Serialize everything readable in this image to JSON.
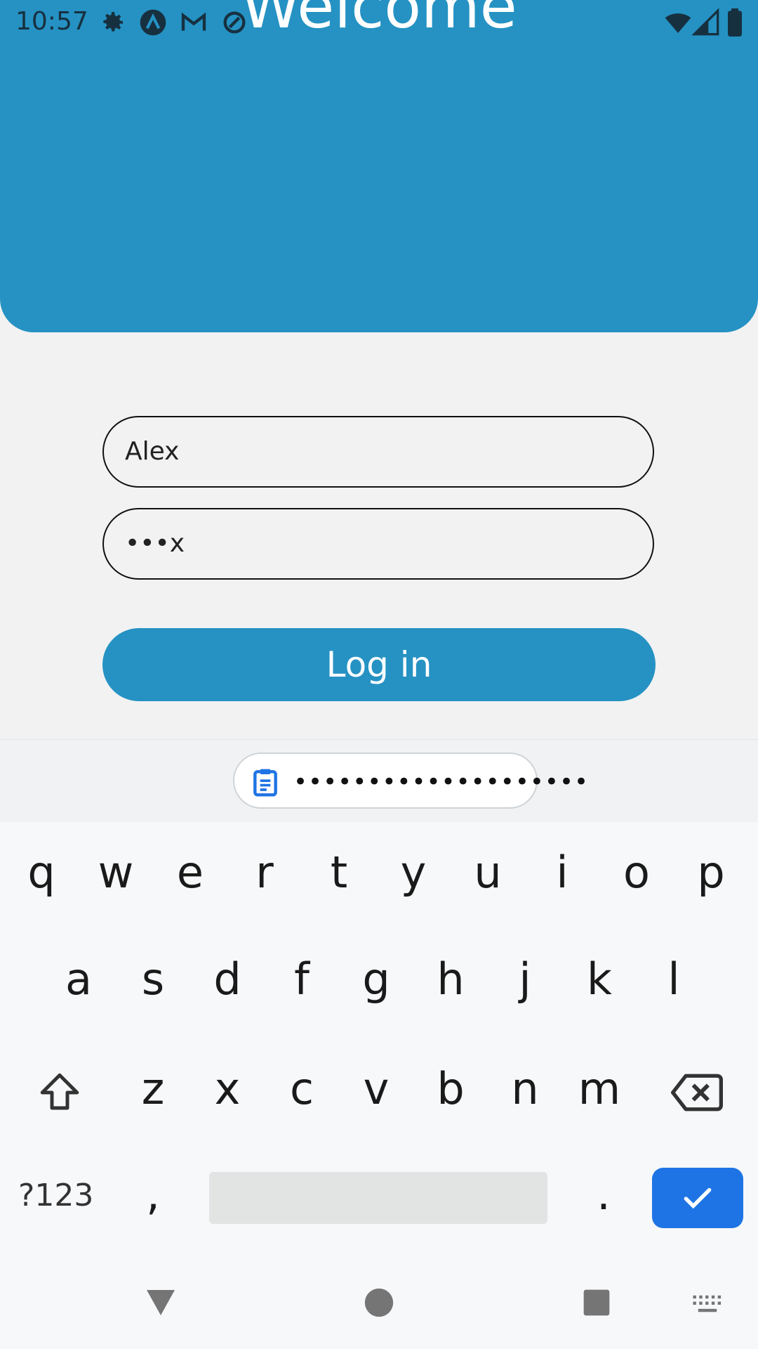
{
  "status_bar": {
    "time": "10:57",
    "left_icons": [
      "gear-icon",
      "app-a-icon",
      "gmail-icon",
      "sync-icon"
    ],
    "right_icons": [
      "wifi-icon",
      "signal-icon",
      "battery-icon"
    ]
  },
  "header": {
    "title": "Welcome",
    "bg_color": "#2592c3"
  },
  "form": {
    "username_value": "Alex",
    "password_value": "•••x",
    "login_label": "Log in"
  },
  "keyboard": {
    "clipboard_suggestion": "••••••••••••••••••••",
    "row1": [
      "q",
      "w",
      "e",
      "r",
      "t",
      "y",
      "u",
      "i",
      "o",
      "p"
    ],
    "row2": [
      "a",
      "s",
      "d",
      "f",
      "g",
      "h",
      "j",
      "k",
      "l"
    ],
    "row3": [
      "z",
      "x",
      "c",
      "v",
      "b",
      "n",
      "m"
    ],
    "symbols_label": "?123",
    "comma_label": ",",
    "period_label": ".",
    "enter_color": "#1e74e4"
  },
  "navigation": [
    "back-icon",
    "home-icon",
    "recents-icon",
    "keyboard-switch-icon"
  ]
}
